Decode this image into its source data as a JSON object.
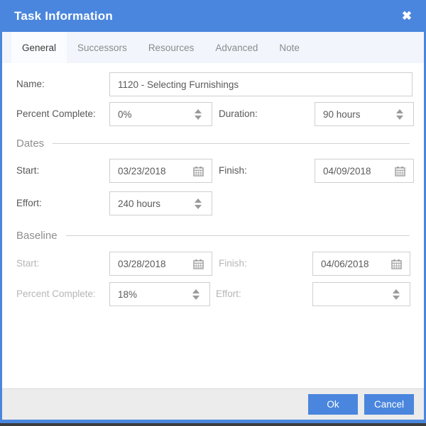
{
  "window": {
    "title": "Task Information",
    "close_icon": "close-icon",
    "accent_color": "#4a86dd",
    "footer_bg": "#ececec"
  },
  "tabs": [
    {
      "label": "General",
      "active": true
    },
    {
      "label": "Successors",
      "active": false
    },
    {
      "label": "Resources",
      "active": false
    },
    {
      "label": "Advanced",
      "active": false
    },
    {
      "label": "Note",
      "active": false
    }
  ],
  "form": {
    "name": {
      "label": "Name:",
      "value": "1120 - Selecting Furnishings"
    },
    "percent_complete": {
      "label": "Percent Complete:",
      "value": "0%"
    },
    "duration": {
      "label": "Duration:",
      "value": "90 hours"
    }
  },
  "dates": {
    "section_title": "Dates",
    "start": {
      "label": "Start:",
      "value": "03/23/2018",
      "icon": "calendar-icon"
    },
    "finish": {
      "label": "Finish:",
      "value": "04/09/2018",
      "icon": "calendar-icon"
    },
    "effort": {
      "label": "Effort:",
      "value": "240 hours"
    }
  },
  "baseline": {
    "section_title": "Baseline",
    "start": {
      "label": "Start:",
      "value": "03/28/2018",
      "icon": "calendar-icon"
    },
    "finish": {
      "label": "Finish:",
      "value": "04/06/2018",
      "icon": "calendar-icon"
    },
    "percent_complete": {
      "label": "Percent Complete:",
      "value": "18%"
    },
    "effort": {
      "label": "Effort:",
      "value": ""
    }
  },
  "footer": {
    "ok_label": "Ok",
    "cancel_label": "Cancel"
  }
}
